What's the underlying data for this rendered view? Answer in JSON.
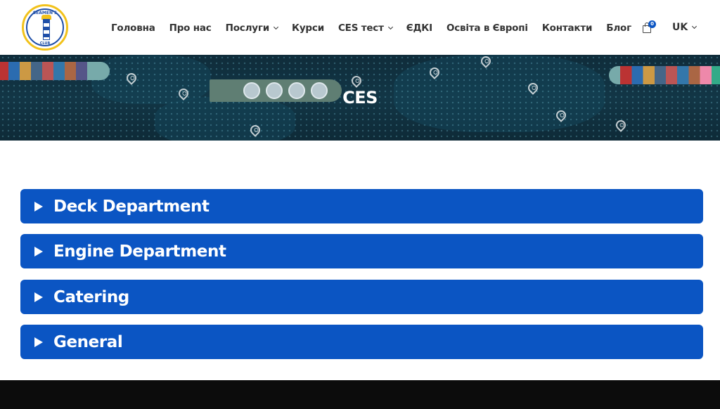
{
  "header": {
    "logo": {
      "text_top": "SEAMEN'S",
      "text_bottom": "CLUB"
    },
    "nav": [
      {
        "label": "Головна",
        "has_dropdown": false
      },
      {
        "label": "Про нас",
        "has_dropdown": false
      },
      {
        "label": "Послуги",
        "has_dropdown": true
      },
      {
        "label": "Курси",
        "has_dropdown": false
      },
      {
        "label": "CES тест",
        "has_dropdown": true
      },
      {
        "label": "ЄДКІ",
        "has_dropdown": false
      },
      {
        "label": "Освіта в Європі",
        "has_dropdown": false
      },
      {
        "label": "Контакти",
        "has_dropdown": false
      },
      {
        "label": "Блог",
        "has_dropdown": false
      }
    ],
    "cart": {
      "count": "0",
      "icon": "shopping-bag-icon"
    },
    "language": "UK"
  },
  "hero": {
    "title": "CES"
  },
  "accordion": [
    {
      "label": "Deck Department"
    },
    {
      "label": "Engine Department"
    },
    {
      "label": "Catering"
    },
    {
      "label": "General"
    }
  ],
  "colors": {
    "accent": "#0b55c3",
    "hero_bg": "#123646",
    "footer": "#0c0c0c",
    "logo_ring": "#f2c21b"
  }
}
